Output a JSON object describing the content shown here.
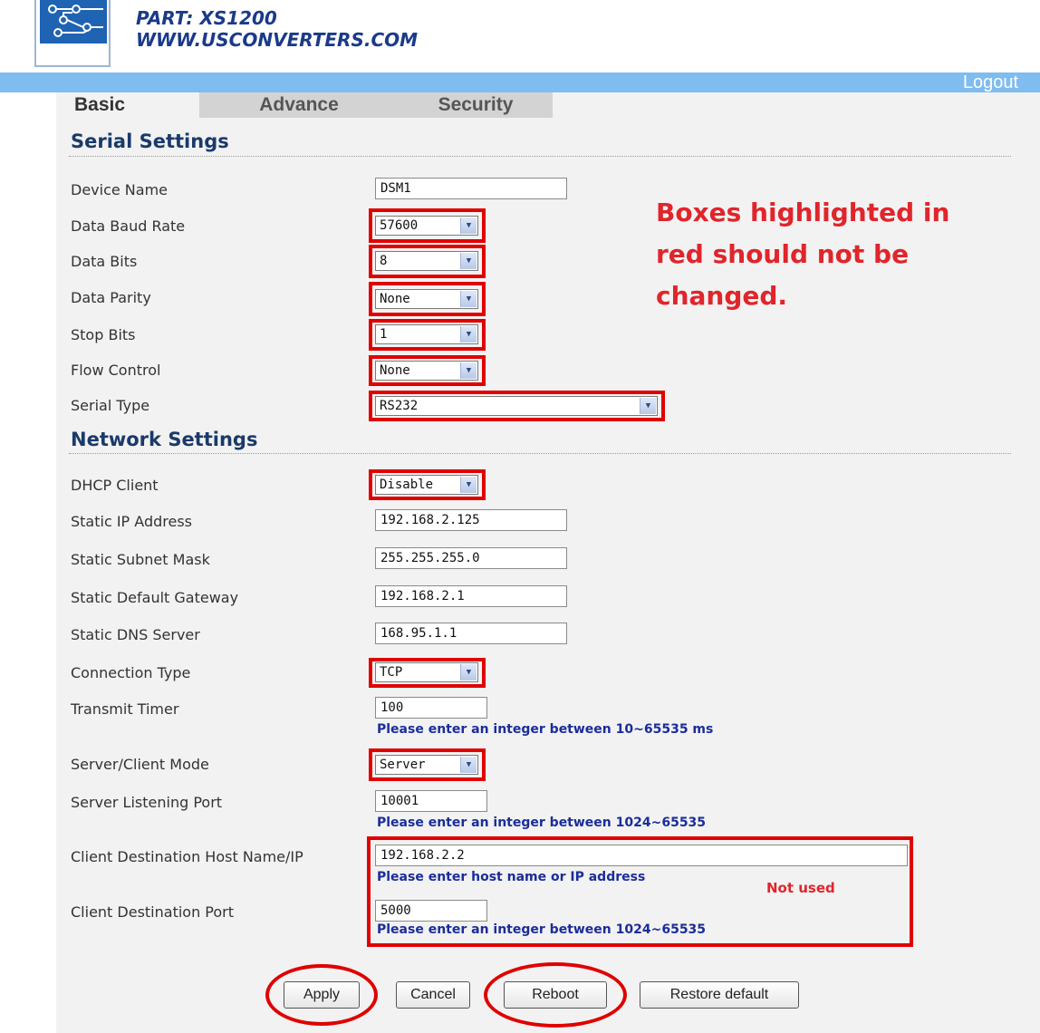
{
  "header": {
    "part": "PART: XS1200",
    "website": "WWW.USCONVERTERS.COM",
    "logout": "Logout"
  },
  "tabs": [
    "Basic",
    "Advance",
    "Security"
  ],
  "serial": {
    "title": "Serial Settings",
    "device_name": {
      "label": "Device Name",
      "value": "DSM1"
    },
    "baud_rate": {
      "label": "Data Baud Rate",
      "value": "57600"
    },
    "data_bits": {
      "label": "Data Bits",
      "value": "8"
    },
    "parity": {
      "label": "Data Parity",
      "value": "None"
    },
    "stop_bits": {
      "label": "Stop Bits",
      "value": "1"
    },
    "flow_control": {
      "label": "Flow Control",
      "value": "None"
    },
    "serial_type": {
      "label": "Serial Type",
      "value": "RS232"
    }
  },
  "network": {
    "title": "Network Settings",
    "dhcp": {
      "label": "DHCP Client",
      "value": "Disable"
    },
    "ip": {
      "label": "Static IP Address",
      "value": "192.168.2.125"
    },
    "mask": {
      "label": "Static Subnet Mask",
      "value": "255.255.255.0"
    },
    "gateway": {
      "label": "Static Default Gateway",
      "value": "192.168.2.1"
    },
    "dns": {
      "label": "Static DNS Server",
      "value": "168.95.1.1"
    },
    "conn_type": {
      "label": "Connection Type",
      "value": "TCP"
    },
    "timer": {
      "label": "Transmit Timer",
      "value": "100",
      "hint": "Please enter an integer between 10~65535 ms"
    },
    "mode": {
      "label": "Server/Client Mode",
      "value": "Server"
    },
    "listen_port": {
      "label": "Server Listening Port",
      "value": "10001",
      "hint": "Please enter an integer between 1024~65535"
    },
    "dest_host": {
      "label": "Client Destination Host Name/IP",
      "value": "192.168.2.2",
      "hint": "Please enter host name or IP address"
    },
    "dest_port": {
      "label": "Client Destination Port",
      "value": "5000",
      "hint": "Please enter an integer between 1024~65535"
    }
  },
  "annotations": {
    "note_line1": "Boxes highlighted in",
    "note_line2": "red should not be",
    "note_line3": "changed.",
    "not_used": "Not used",
    "highlight_color": "#e00000"
  },
  "buttons": {
    "apply": "Apply",
    "cancel": "Cancel",
    "reboot": "Reboot",
    "restore": "Restore default"
  },
  "colors": {
    "topbar": "#7fbcf0",
    "section_title": "#1a3a6a",
    "hint": "#1b2d9a"
  }
}
